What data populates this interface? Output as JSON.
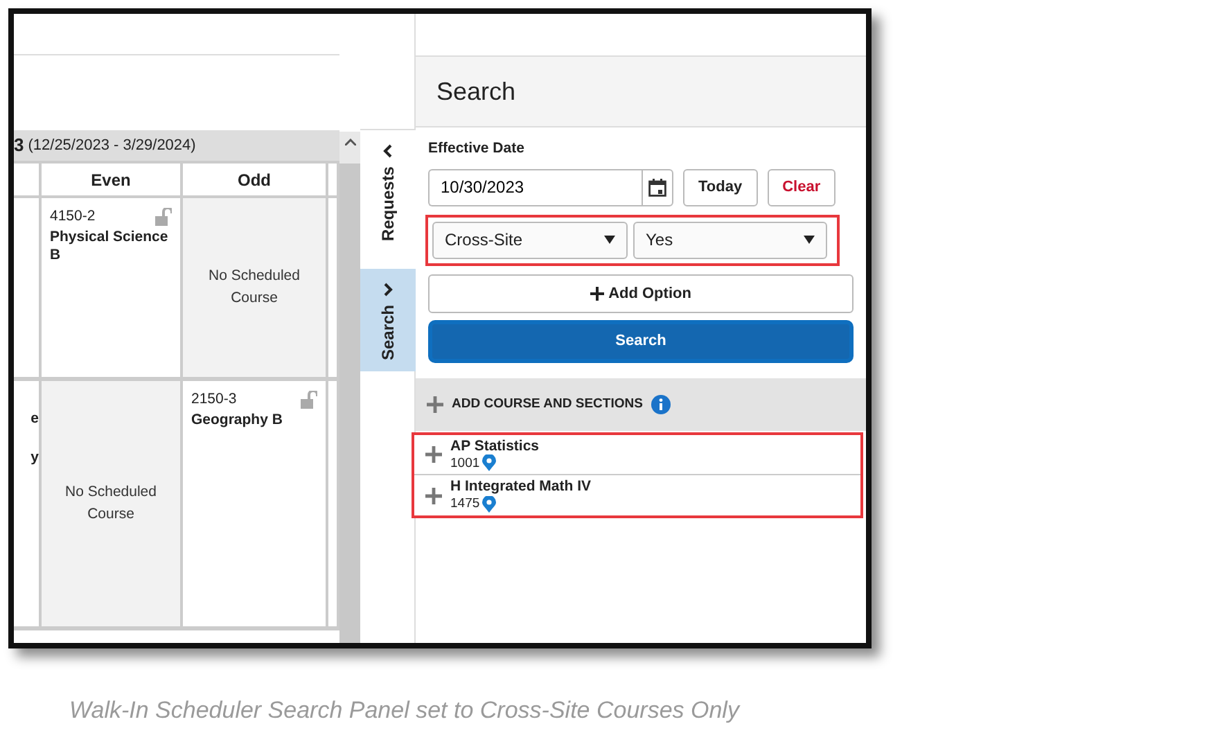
{
  "schedule": {
    "term_number": "3",
    "term_dates": "(12/25/2023 - 3/29/2024)",
    "columns": [
      "Even",
      "Odd"
    ],
    "rows": [
      {
        "cut_cell": [],
        "cells": [
          {
            "kind": "course",
            "section": "4150-2",
            "name": "Physical Science B"
          },
          {
            "kind": "empty",
            "text": "No Scheduled Course"
          }
        ]
      },
      {
        "cut_cell": [
          "e",
          "y"
        ],
        "cells": [
          {
            "kind": "empty",
            "text": "No Scheduled Course"
          },
          {
            "kind": "course",
            "section": "2150-3",
            "name": "Geography B"
          }
        ]
      }
    ]
  },
  "side_tabs": [
    {
      "label": "Requests",
      "kind": "collapse",
      "selected": false
    },
    {
      "label": "Search",
      "kind": "expand",
      "selected": true
    }
  ],
  "search_panel": {
    "title": "Search",
    "date_label": "Effective Date",
    "date_value": "10/30/2023",
    "today_button": "Today",
    "clear_button": "Clear",
    "filters": [
      {
        "value": "Cross-Site"
      },
      {
        "value": "Yes"
      }
    ],
    "filters_highlighted": true,
    "add_option_button": "Add Option",
    "search_button": "Search",
    "results_header": "ADD COURSE AND SECTIONS",
    "results": [
      {
        "name": "AP Statistics",
        "number": "1001"
      },
      {
        "name": "H Integrated Math IV",
        "number": "1475"
      }
    ],
    "results_highlighted": true
  },
  "caption": "Walk-In Scheduler Search Panel set to Cross-Site Courses Only"
}
